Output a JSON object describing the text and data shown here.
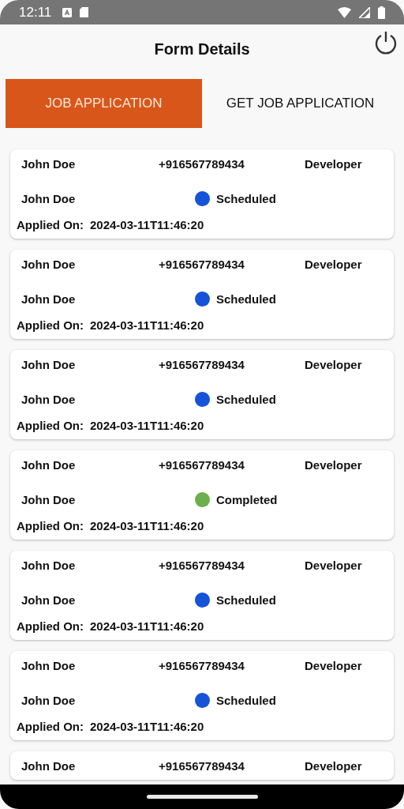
{
  "status_bar": {
    "time": "12:11"
  },
  "header": {
    "title": "Form Details"
  },
  "tabs": [
    {
      "label": "JOB APPLICATION",
      "selected": true
    },
    {
      "label": "GET JOB APPLICATION",
      "selected": false
    }
  ],
  "applications": [
    {
      "name": "John Doe",
      "phone": "+916567789434",
      "role": "Developer",
      "contact": "John Doe",
      "status": "Scheduled",
      "color": "#1553d8",
      "applied_label": "Applied On:",
      "applied_on": "2024-03-11T11:46:20"
    },
    {
      "name": "John Doe",
      "phone": "+916567789434",
      "role": "Developer",
      "contact": "John Doe",
      "status": "Scheduled",
      "color": "#1553d8",
      "applied_label": "Applied On:",
      "applied_on": "2024-03-11T11:46:20"
    },
    {
      "name": "John Doe",
      "phone": "+916567789434",
      "role": "Developer",
      "contact": "John Doe",
      "status": "Scheduled",
      "color": "#1553d8",
      "applied_label": "Applied On:",
      "applied_on": "2024-03-11T11:46:20"
    },
    {
      "name": "John Doe",
      "phone": "+916567789434",
      "role": "Developer",
      "contact": "John Doe",
      "status": "Completed",
      "color": "#6ab04c",
      "applied_label": "Applied On:",
      "applied_on": "2024-03-11T11:46:20"
    },
    {
      "name": "John Doe",
      "phone": "+916567789434",
      "role": "Developer",
      "contact": "John Doe",
      "status": "Scheduled",
      "color": "#1553d8",
      "applied_label": "Applied On:",
      "applied_on": "2024-03-11T11:46:20"
    },
    {
      "name": "John Doe",
      "phone": "+916567789434",
      "role": "Developer",
      "contact": "John Doe",
      "status": "Scheduled",
      "color": "#1553d8",
      "applied_label": "Applied On:",
      "applied_on": "2024-03-11T11:46:20"
    },
    {
      "name": "John Doe",
      "phone": "+916567789434",
      "role": "Developer"
    }
  ]
}
